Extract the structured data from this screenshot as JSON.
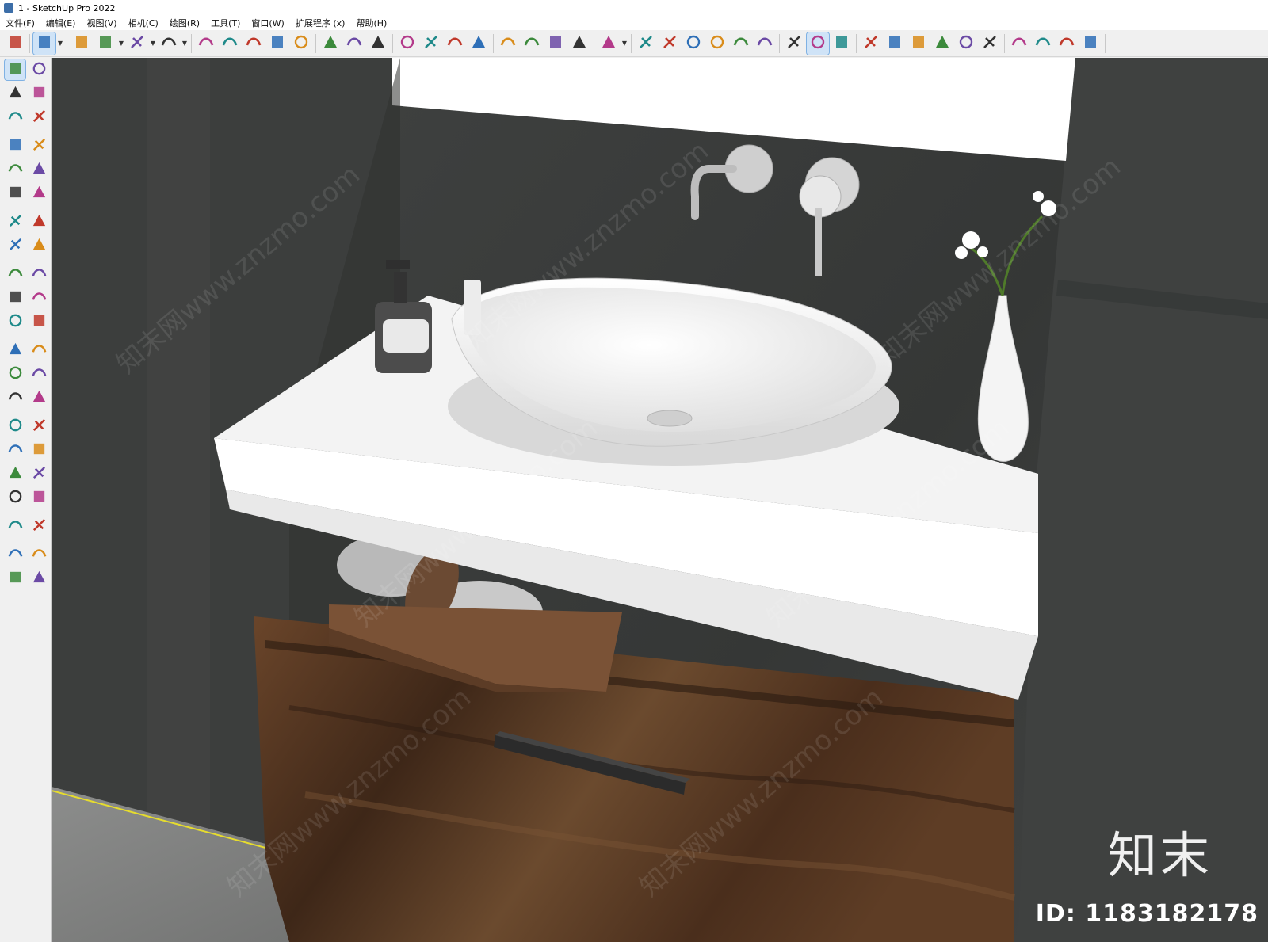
{
  "window": {
    "title": "1 - SketchUp Pro 2022"
  },
  "menu": [
    "文件(F)",
    "编辑(E)",
    "视图(V)",
    "相机(C)",
    "绘图(R)",
    "工具(T)",
    "窗口(W)",
    "扩展程序 (x)",
    "帮助(H)"
  ],
  "toolbar": {
    "tools": [
      "search-icon",
      "select-icon",
      "eraser-icon",
      "pencil-icon",
      "arc-icon",
      "rectangle-icon",
      "push-pull-icon",
      "follow-me-icon",
      "move-icon",
      "rotate-icon",
      "scale-icon",
      "tape-measure-icon",
      "text-icon",
      "paint-bucket-icon",
      "orbit-icon",
      "pan-icon",
      "zoom-icon",
      "zoom-extents-icon",
      "warehouse-icon",
      "extension-warehouse-icon",
      "layout-icon",
      "extension-manager-icon",
      "user-account-icon",
      "iso-view-icon",
      "top-view-icon",
      "front-view-icon",
      "right-view-icon",
      "back-view-icon",
      "left-view-icon",
      "section-plane-icon",
      "section-display-icon",
      "section-cut-icon",
      "add-icon",
      "shield-icon",
      "report-icon",
      "checker-icon",
      "cloud-icon",
      "settings-icon",
      "chat-icon",
      "info-icon",
      "cart-icon",
      "avatar-icon"
    ]
  },
  "left_tools": [
    "select-icon",
    "orbit-icon",
    "paint-bucket-icon",
    "eraser-icon",
    "component-icon",
    "tag-icon",
    "pencil-icon",
    "freehand-icon",
    "rectangle-icon",
    "rotated-rectangle-icon",
    "circle-icon",
    "polygon-icon",
    "arc-icon",
    "arc-2pt-icon",
    "pie-icon",
    "arc-3pt-icon",
    "move-icon",
    "push-pull-icon",
    "rotate-icon",
    "follow-me-icon",
    "scale-icon",
    "offset-icon",
    "tape-measure-icon",
    "dimension-icon",
    "protractor-icon",
    "text-icon",
    "axes-icon",
    "3d-text-icon",
    "orbit-icon",
    "pan-icon",
    "zoom-icon",
    "zoom-window-icon",
    "zoom-extents-icon",
    "previous-view-icon",
    "position-camera-icon",
    "look-around-icon",
    "walk-icon",
    "section-plane-icon",
    "warehouse-icon",
    "extension-icon",
    "layers-icon",
    "sandbox-icon"
  ],
  "watermark": {
    "logo": "知末",
    "id": "ID: 1183182178",
    "site": "知末网www.znzmo.com"
  },
  "colors": {
    "wall": "#3f4140",
    "counter": "#f4f4f4",
    "wood": "#5a3a24",
    "accent": "#cfe3f7"
  }
}
